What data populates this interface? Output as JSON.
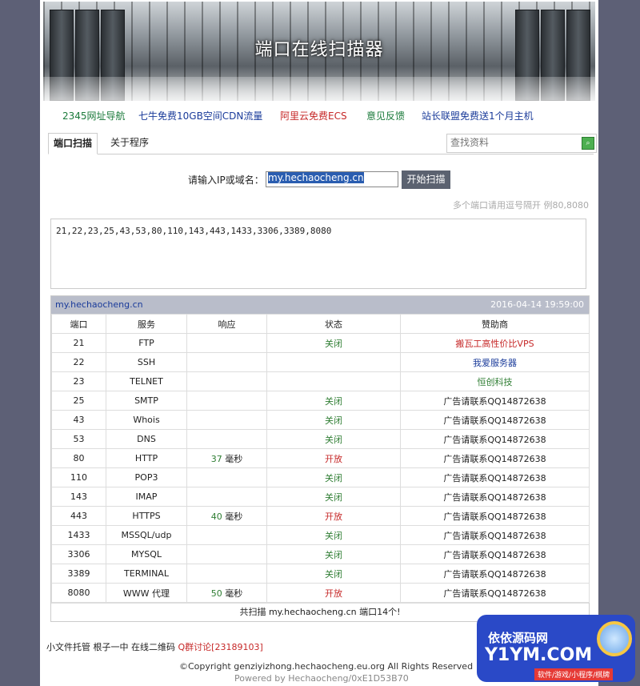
{
  "banner": {
    "title": "端口在线扫描器"
  },
  "nav": [
    {
      "label": "2345网址导航",
      "color": "#1a7a3a"
    },
    {
      "label": "七牛免费10GB空间CDN流量",
      "color": "#1a3b9a"
    },
    {
      "label": "阿里云免费ECS",
      "color": "#c62828"
    },
    {
      "label": "意见反馈",
      "color": "#1a7a3a"
    },
    {
      "label": "站长联盟免费送1个月主机",
      "color": "#1a3b9a"
    }
  ],
  "tabs": {
    "scan": "端口扫描",
    "about": "关于程序"
  },
  "search": {
    "placeholder": "查找资料"
  },
  "form": {
    "label": "请输入IP或域名：",
    "value": "my.hechaocheng.cn",
    "button": "开始扫描"
  },
  "hint": "多个端口请用逗号隔开 例80,8080",
  "ports": "21,22,23,25,43,53,80,110,143,443,1433,3306,3389,8080",
  "result": {
    "host": "my.hechaocheng.cn",
    "time": "2016-04-14 19:59:00",
    "headers": [
      "端口",
      "服务",
      "响应",
      "状态",
      "赞助商"
    ],
    "rows": [
      {
        "port": "21",
        "service": "FTP",
        "ms": "",
        "status": "关闭",
        "sponsor": "搬瓦工高性价比VPS",
        "sponsor_color": "red"
      },
      {
        "port": "22",
        "service": "SSH",
        "ms": "",
        "status": "",
        "sponsor": "我爱服务器",
        "sponsor_color": "blue"
      },
      {
        "port": "23",
        "service": "TELNET",
        "ms": "",
        "status": "",
        "sponsor": "恒创科技",
        "sponsor_color": "green"
      },
      {
        "port": "25",
        "service": "SMTP",
        "ms": "",
        "status": "关闭",
        "sponsor": "广告请联系QQ14872638",
        "sponsor_color": ""
      },
      {
        "port": "43",
        "service": "Whois",
        "ms": "",
        "status": "关闭",
        "sponsor": "广告请联系QQ14872638",
        "sponsor_color": ""
      },
      {
        "port": "53",
        "service": "DNS",
        "ms": "",
        "status": "关闭",
        "sponsor": "广告请联系QQ14872638",
        "sponsor_color": ""
      },
      {
        "port": "80",
        "service": "HTTP",
        "ms": "37",
        "status": "开放",
        "sponsor": "广告请联系QQ14872638",
        "sponsor_color": ""
      },
      {
        "port": "110",
        "service": "POP3",
        "ms": "",
        "status": "关闭",
        "sponsor": "广告请联系QQ14872638",
        "sponsor_color": ""
      },
      {
        "port": "143",
        "service": "IMAP",
        "ms": "",
        "status": "关闭",
        "sponsor": "广告请联系QQ14872638",
        "sponsor_color": ""
      },
      {
        "port": "443",
        "service": "HTTPS",
        "ms": "40",
        "status": "开放",
        "sponsor": "广告请联系QQ14872638",
        "sponsor_color": ""
      },
      {
        "port": "1433",
        "service": "MSSQL/udp",
        "ms": "",
        "status": "关闭",
        "sponsor": "广告请联系QQ14872638",
        "sponsor_color": ""
      },
      {
        "port": "3306",
        "service": "MYSQL",
        "ms": "",
        "status": "关闭",
        "sponsor": "广告请联系QQ14872638",
        "sponsor_color": ""
      },
      {
        "port": "3389",
        "service": "TERMINAL",
        "ms": "",
        "status": "关闭",
        "sponsor": "广告请联系QQ14872638",
        "sponsor_color": ""
      },
      {
        "port": "8080",
        "service": "WWW 代理",
        "ms": "50",
        "status": "开放",
        "sponsor": "广告请联系QQ14872638",
        "sponsor_color": ""
      }
    ],
    "ms_unit": "毫秒",
    "summary": "共扫描 my.hechaocheng.cn 端口14个!"
  },
  "footer": {
    "links": "小文件托管 根子一中 在线二维码 ",
    "qq": "Q群讨论[23189103]",
    "copyright": "©Copyright genziyizhong.hechaocheng.eu.org All Rights Reserved",
    "powered": "Powered by Hechaocheng/0xE1D53B70"
  },
  "watermark": {
    "top": "依依源码网",
    "big": "Y1YM.COM",
    "sub": "软件/游戏/小程序/棋牌"
  }
}
